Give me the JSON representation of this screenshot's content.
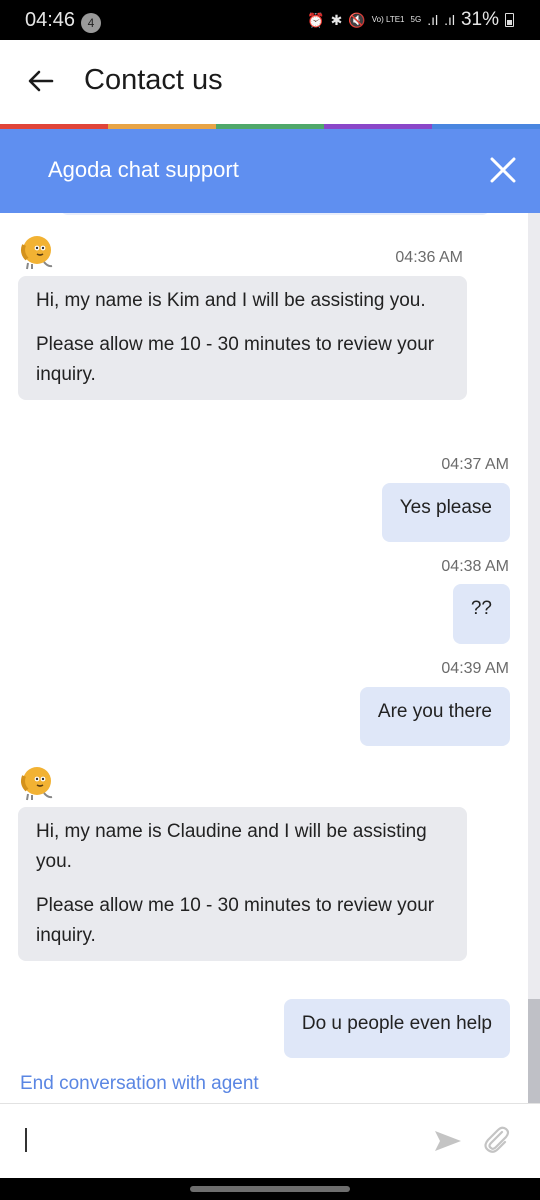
{
  "status_bar": {
    "time": "04:46",
    "notification_count": "4",
    "network_label": "Vo) LTE1",
    "network_type": "5G",
    "battery_percent": "31%",
    "icons": [
      "alarm-icon",
      "bluetooth-icon",
      "mute-icon",
      "volte-icon",
      "5g-icon",
      "signal-icon",
      "signal-icon",
      "battery-icon"
    ]
  },
  "app_bar": {
    "title": "Contact us",
    "back_icon": "arrow-left-icon"
  },
  "rainbow_colors": [
    "#e0453a",
    "#e8a446",
    "#4fa86a",
    "#8a47c8",
    "#4a86e0"
  ],
  "chat_header": {
    "title": "Agoda chat support",
    "background": "#5f8ff0",
    "close_icon": "close-icon"
  },
  "messages": [
    {
      "sender": "agent",
      "time": "04:36 AM",
      "paragraphs": [
        "Hi, my name is Kim and I will be assisting you.",
        "Please allow me 10 - 30 minutes to review your inquiry."
      ]
    },
    {
      "sender": "user",
      "time": "04:37 AM",
      "text": "Yes please"
    },
    {
      "sender": "user",
      "time": "04:38 AM",
      "text": "??"
    },
    {
      "sender": "user",
      "time": "04:39 AM",
      "text": "Are you there"
    },
    {
      "sender": "agent",
      "time": "",
      "paragraphs": [
        "Hi, my name is Claudine and I will be assisting you.",
        "Please allow me 10 - 30 minutes to review your inquiry."
      ]
    },
    {
      "sender": "user",
      "time": "",
      "text": "Do u people even help"
    }
  ],
  "end_conversation_label": "End conversation with agent",
  "input": {
    "value": "",
    "placeholder": "",
    "send_icon": "send-icon",
    "attach_icon": "paperclip-icon"
  },
  "colors": {
    "agent_bubble": "#e9eaee",
    "user_bubble": "#dfe7f8",
    "link": "#5a86e3"
  }
}
